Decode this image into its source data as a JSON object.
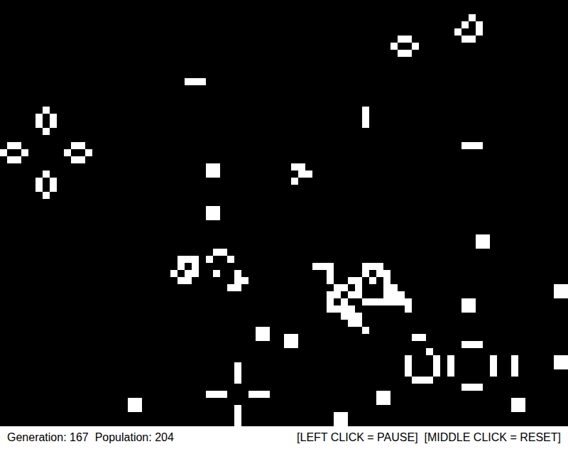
{
  "board": {
    "columns": 80,
    "rows": 60,
    "live_cells": [
      [
        66,
        2
      ],
      [
        65,
        3
      ],
      [
        67,
        3
      ],
      [
        64,
        4
      ],
      [
        67,
        4
      ],
      [
        65,
        5
      ],
      [
        66,
        5
      ],
      [
        56,
        5
      ],
      [
        57,
        5
      ],
      [
        55,
        6
      ],
      [
        58,
        6
      ],
      [
        56,
        7
      ],
      [
        57,
        7
      ],
      [
        26,
        11
      ],
      [
        27,
        11
      ],
      [
        28,
        11
      ],
      [
        51,
        15
      ],
      [
        51,
        16
      ],
      [
        51,
        17
      ],
      [
        65,
        20
      ],
      [
        66,
        20
      ],
      [
        67,
        20
      ],
      [
        6,
        15
      ],
      [
        5,
        16
      ],
      [
        7,
        16
      ],
      [
        5,
        17
      ],
      [
        7,
        17
      ],
      [
        6,
        18
      ],
      [
        1,
        20
      ],
      [
        2,
        20
      ],
      [
        0,
        21
      ],
      [
        3,
        21
      ],
      [
        1,
        22
      ],
      [
        2,
        22
      ],
      [
        10,
        20
      ],
      [
        11,
        20
      ],
      [
        9,
        21
      ],
      [
        12,
        21
      ],
      [
        10,
        22
      ],
      [
        11,
        22
      ],
      [
        6,
        24
      ],
      [
        5,
        25
      ],
      [
        7,
        25
      ],
      [
        5,
        26
      ],
      [
        7,
        26
      ],
      [
        6,
        27
      ],
      [
        29,
        23
      ],
      [
        30,
        23
      ],
      [
        29,
        24
      ],
      [
        30,
        24
      ],
      [
        29,
        29
      ],
      [
        30,
        29
      ],
      [
        29,
        30
      ],
      [
        30,
        30
      ],
      [
        67,
        33
      ],
      [
        68,
        33
      ],
      [
        67,
        34
      ],
      [
        68,
        34
      ],
      [
        78,
        40
      ],
      [
        79,
        40
      ],
      [
        78,
        41
      ],
      [
        79,
        41
      ],
      [
        65,
        42
      ],
      [
        66,
        42
      ],
      [
        65,
        43
      ],
      [
        66,
        43
      ],
      [
        36,
        46
      ],
      [
        37,
        46
      ],
      [
        36,
        47
      ],
      [
        37,
        47
      ],
      [
        40,
        47
      ],
      [
        41,
        47
      ],
      [
        40,
        48
      ],
      [
        41,
        48
      ],
      [
        78,
        50
      ],
      [
        79,
        50
      ],
      [
        78,
        51
      ],
      [
        79,
        51
      ],
      [
        18,
        56
      ],
      [
        19,
        56
      ],
      [
        18,
        57
      ],
      [
        19,
        57
      ],
      [
        53,
        55
      ],
      [
        54,
        55
      ],
      [
        53,
        56
      ],
      [
        54,
        56
      ],
      [
        72,
        56
      ],
      [
        73,
        56
      ],
      [
        72,
        57
      ],
      [
        73,
        57
      ],
      [
        47,
        58
      ],
      [
        48,
        58
      ],
      [
        47,
        59
      ],
      [
        48,
        59
      ],
      [
        41,
        23
      ],
      [
        42,
        23
      ],
      [
        42,
        24
      ],
      [
        43,
        24
      ],
      [
        41,
        25
      ],
      [
        25,
        36
      ],
      [
        26,
        36
      ],
      [
        27,
        36
      ],
      [
        25,
        37
      ],
      [
        27,
        37
      ],
      [
        24,
        38
      ],
      [
        26,
        38
      ],
      [
        27,
        38
      ],
      [
        25,
        39
      ],
      [
        26,
        39
      ],
      [
        30,
        35
      ],
      [
        31,
        35
      ],
      [
        29,
        36
      ],
      [
        32,
        36
      ],
      [
        30,
        38
      ],
      [
        33,
        38
      ],
      [
        33,
        39
      ],
      [
        34,
        39
      ],
      [
        32,
        40
      ],
      [
        33,
        40
      ],
      [
        44,
        37
      ],
      [
        45,
        37
      ],
      [
        46,
        37
      ],
      [
        51,
        37
      ],
      [
        52,
        37
      ],
      [
        53,
        37
      ],
      [
        46,
        38
      ],
      [
        51,
        38
      ],
      [
        53,
        38
      ],
      [
        54,
        38
      ],
      [
        46,
        39
      ],
      [
        49,
        39
      ],
      [
        50,
        39
      ],
      [
        52,
        39
      ],
      [
        54,
        39
      ],
      [
        47,
        40
      ],
      [
        48,
        40
      ],
      [
        50,
        40
      ],
      [
        54,
        40
      ],
      [
        55,
        40
      ],
      [
        46,
        41
      ],
      [
        47,
        41
      ],
      [
        49,
        41
      ],
      [
        50,
        41
      ],
      [
        54,
        41
      ],
      [
        55,
        41
      ],
      [
        56,
        41
      ],
      [
        46,
        42
      ],
      [
        48,
        42
      ],
      [
        51,
        42
      ],
      [
        52,
        42
      ],
      [
        53,
        42
      ],
      [
        54,
        42
      ],
      [
        55,
        42
      ],
      [
        56,
        42
      ],
      [
        57,
        42
      ],
      [
        46,
        43
      ],
      [
        47,
        43
      ],
      [
        48,
        43
      ],
      [
        49,
        43
      ],
      [
        57,
        43
      ],
      [
        48,
        44
      ],
      [
        49,
        44
      ],
      [
        50,
        44
      ],
      [
        49,
        45
      ],
      [
        50,
        45
      ],
      [
        51,
        46
      ],
      [
        58,
        47
      ],
      [
        59,
        47
      ],
      [
        65,
        48
      ],
      [
        66,
        48
      ],
      [
        67,
        48
      ],
      [
        60,
        49
      ],
      [
        57,
        50
      ],
      [
        57,
        51
      ],
      [
        57,
        52
      ],
      [
        61,
        50
      ],
      [
        61,
        51
      ],
      [
        61,
        52
      ],
      [
        63,
        50
      ],
      [
        63,
        51
      ],
      [
        63,
        52
      ],
      [
        69,
        50
      ],
      [
        69,
        51
      ],
      [
        69,
        52
      ],
      [
        72,
        50
      ],
      [
        72,
        51
      ],
      [
        72,
        52
      ],
      [
        58,
        53
      ],
      [
        59,
        53
      ],
      [
        60,
        53
      ],
      [
        65,
        54
      ],
      [
        66,
        54
      ],
      [
        67,
        54
      ],
      [
        33,
        51
      ],
      [
        33,
        52
      ],
      [
        33,
        53
      ],
      [
        29,
        55
      ],
      [
        30,
        55
      ],
      [
        31,
        55
      ],
      [
        35,
        55
      ],
      [
        36,
        55
      ],
      [
        37,
        55
      ],
      [
        33,
        57
      ],
      [
        33,
        58
      ],
      [
        33,
        59
      ]
    ]
  },
  "status_bar": {
    "left_text": "Generation: 167  Population: 204",
    "right_text": "[LEFT CLICK = PAUSE]  [MIDDLE CLICK = RESET]"
  }
}
